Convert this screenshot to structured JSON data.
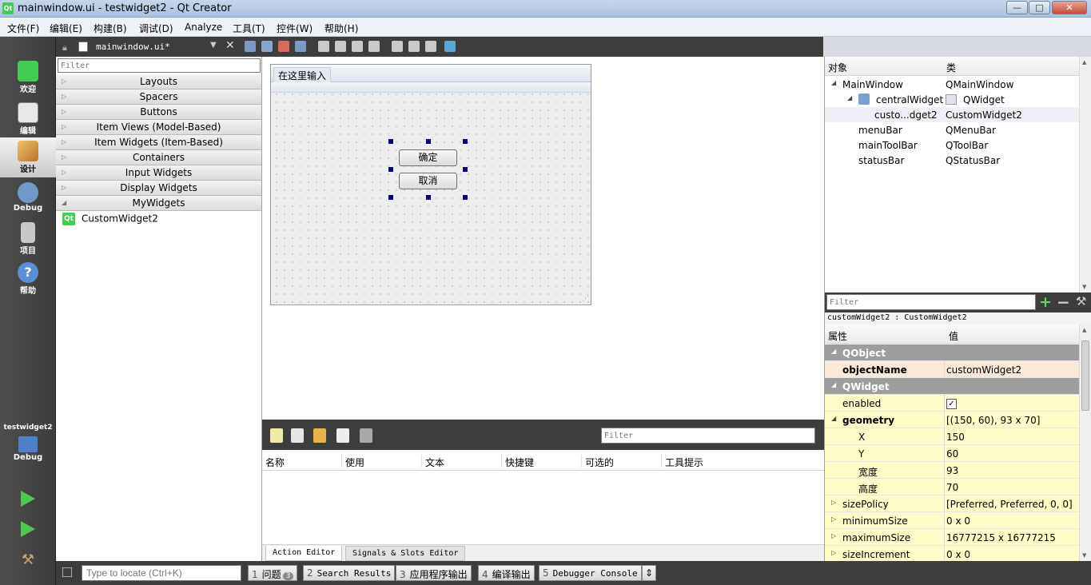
{
  "window": {
    "title": "mainwindow.ui - testwidget2 - Qt Creator",
    "logo": "Qt",
    "minimize": "—",
    "maximize": "□",
    "close": "✕"
  },
  "menubar": [
    "文件(F)",
    "编辑(E)",
    "构建(B)",
    "调试(D)",
    "Analyze",
    "工具(T)",
    "控件(W)",
    "帮助(H)"
  ],
  "modes": [
    {
      "label": "欢迎",
      "icon": "qt-welcome-icon",
      "color": "#41cd52"
    },
    {
      "label": "编辑",
      "icon": "edit-document-icon",
      "color": "#e8e8e8"
    },
    {
      "label": "设计",
      "icon": "design-brush-icon",
      "color": "#d89b3c"
    },
    {
      "label": "Debug",
      "icon": "debug-bug-icon",
      "color": "#6f9ac8"
    },
    {
      "label": "项目",
      "icon": "project-wrench-icon",
      "color": "#c8c8c8"
    },
    {
      "label": "帮助",
      "icon": "help-question-icon",
      "color": "#5b8fd3"
    }
  ],
  "kit": {
    "project": "testwidget2",
    "target": "Debug"
  },
  "editor": {
    "filename": "mainwindow.ui*"
  },
  "widgetbox": {
    "filter_placeholder": "Filter",
    "categories": [
      {
        "label": "Layouts",
        "arrow": "▷"
      },
      {
        "label": "Spacers",
        "arrow": "▷"
      },
      {
        "label": "Buttons",
        "arrow": "▷"
      },
      {
        "label": "Item Views (Model-Based)",
        "arrow": "▷"
      },
      {
        "label": "Item Widgets (Item-Based)",
        "arrow": "▷"
      },
      {
        "label": "Containers",
        "arrow": "▷"
      },
      {
        "label": "Input Widgets",
        "arrow": "▷"
      },
      {
        "label": "Display Widgets",
        "arrow": "▷"
      },
      {
        "label": "MyWidgets",
        "arrow": "◢"
      }
    ],
    "custom_item": "CustomWidget2"
  },
  "form": {
    "menu_hint": "在这里输入",
    "ok_button": "确定",
    "cancel_button": "取消"
  },
  "action_editor": {
    "filter_placeholder": "Filter",
    "columns": [
      "名称",
      "使用",
      "文本",
      "快捷键",
      "可选的",
      "工具提示"
    ],
    "tabs": [
      "Action Editor",
      "Signals & Slots Editor"
    ]
  },
  "object_inspector": {
    "headers": [
      "对象",
      "类"
    ],
    "rows": [
      {
        "object": "MainWindow",
        "class": "QMainWindow",
        "arrow": "◢"
      },
      {
        "object": "centralWidget",
        "class": "QWidget",
        "arrow": "◢"
      },
      {
        "object": "custo...dget2",
        "class": "CustomWidget2",
        "arrow": ""
      },
      {
        "object": "menuBar",
        "class": "QMenuBar",
        "arrow": ""
      },
      {
        "object": "mainToolBar",
        "class": "QToolBar",
        "arrow": ""
      },
      {
        "object": "statusBar",
        "class": "QStatusBar",
        "arrow": ""
      }
    ]
  },
  "property_editor": {
    "filter_placeholder": "Filter",
    "class_line": "customWidget2 : CustomWidget2",
    "headers": [
      "属性",
      "值"
    ],
    "rows": [
      {
        "key": "QObject",
        "value": "",
        "arrow": "◢"
      },
      {
        "key": "objectName",
        "value": "customWidget2",
        "arrow": ""
      },
      {
        "key": "QWidget",
        "value": "",
        "arrow": "◢"
      },
      {
        "key": "enabled",
        "value": "✓",
        "arrow": ""
      },
      {
        "key": "geometry",
        "value": "[(150, 60), 93 x 70]",
        "arrow": "◢"
      },
      {
        "key": "X",
        "value": "150",
        "arrow": ""
      },
      {
        "key": "Y",
        "value": "60",
        "arrow": ""
      },
      {
        "key": "宽度",
        "value": "93",
        "arrow": ""
      },
      {
        "key": "高度",
        "value": "70",
        "arrow": ""
      },
      {
        "key": "sizePolicy",
        "value": "[Preferred, Preferred, 0, 0]",
        "arrow": "▷"
      },
      {
        "key": "minimumSize",
        "value": "0 x 0",
        "arrow": "▷"
      },
      {
        "key": "maximumSize",
        "value": "16777215 x 16777215",
        "arrow": "▷"
      },
      {
        "key": "sizeIncrement",
        "value": "0 x 0",
        "arrow": "▷"
      }
    ]
  },
  "statusbar": {
    "locator_placeholder": "Type to locate (Ctrl+K)",
    "tabs": [
      {
        "num": "1",
        "label": "问题",
        "badge": "3"
      },
      {
        "num": "2",
        "label": "Search Results",
        "badge": ""
      },
      {
        "num": "3",
        "label": "应用程序输出",
        "badge": ""
      },
      {
        "num": "4",
        "label": "编译输出",
        "badge": ""
      },
      {
        "num": "5",
        "label": "Debugger Console",
        "badge": ""
      }
    ]
  }
}
